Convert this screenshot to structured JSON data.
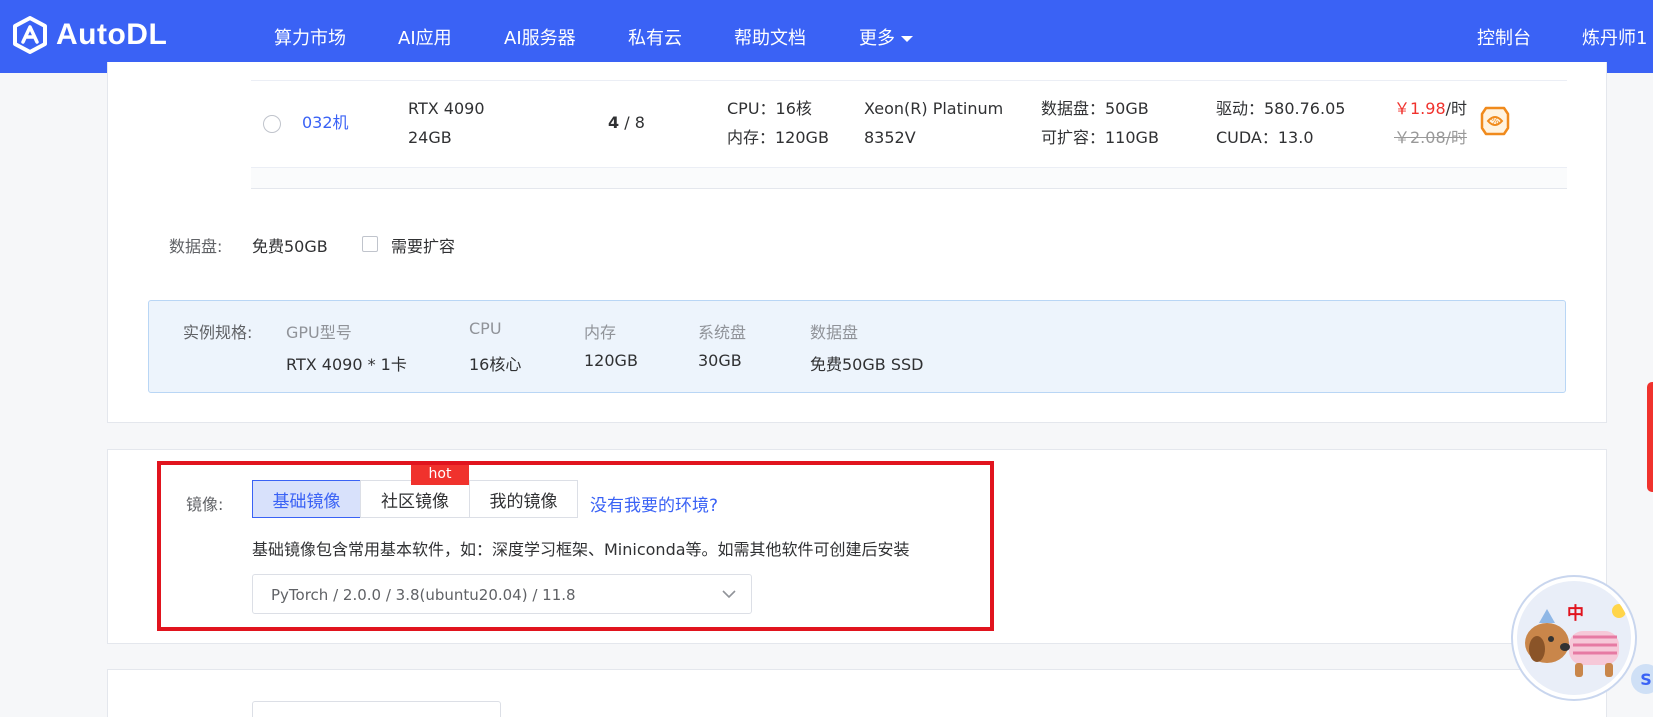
{
  "header": {
    "logo_text": "AutoDL",
    "nav": [
      {
        "label": "算力市场"
      },
      {
        "label": "AI应用"
      },
      {
        "label": "AI服务器"
      },
      {
        "label": "私有云"
      },
      {
        "label": "帮助文档"
      },
      {
        "label": "更多"
      }
    ],
    "console_label": "控制台",
    "user_label": "炼丹师1"
  },
  "machine": {
    "name": "032机",
    "gpu_model": "RTX 4090",
    "gpu_mem": "24GB",
    "gpu_free": "4",
    "gpu_total": "/ 8",
    "cpu": "CPU：16核",
    "memory": "内存：120GB",
    "cpu_model_1": "Xeon(R) Platinum",
    "cpu_model_2": "8352V",
    "disk": "数据盘：50GB",
    "disk_expand": "可扩容：110GB",
    "driver": "驱动：580.76.05",
    "cuda": "CUDA：13.0",
    "price": "￥1.98",
    "price_unit": "/时",
    "original_price": "￥2.08/时",
    "discount_icon": "discount-tag-icon"
  },
  "data_disk": {
    "label": "数据盘:",
    "value": "免费50GB",
    "expand_label": "需要扩容"
  },
  "spec": {
    "label": "实例规格:",
    "columns": [
      {
        "title": "GPU型号",
        "value": "RTX 4090 * 1卡"
      },
      {
        "title": "CPU",
        "value": "16核心"
      },
      {
        "title": "内存",
        "value": "120GB"
      },
      {
        "title": "系统盘",
        "value": "30GB"
      },
      {
        "title": "数据盘",
        "value": "免费50GB SSD"
      }
    ]
  },
  "mirror": {
    "label": "镜像:",
    "tabs": [
      {
        "label": "基础镜像",
        "active": true
      },
      {
        "label": "社区镜像",
        "badge": "hot"
      },
      {
        "label": "我的镜像"
      }
    ],
    "missing_link": "没有我要的环境?",
    "description": "基础镜像包含常用基本软件，如：深度学习框架、Miniconda等。如需其他软件可创建后安装",
    "selected": "PyTorch / 2.0.0 / 3.8(ubuntu20.04) / 11.8"
  },
  "mascot_badge": "中",
  "colors": {
    "accent": "#3a62f5",
    "price_red": "#f0322d",
    "highlight_box": "#e1141e",
    "spec_bg": "#edf4fc"
  }
}
